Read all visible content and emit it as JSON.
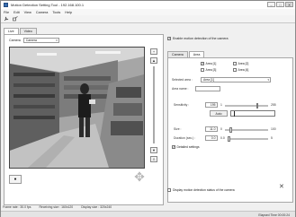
{
  "window": {
    "title": "Motion Detection Setting Tool - 192.168.100.1",
    "controls": [
      "–",
      "□",
      "✕"
    ]
  },
  "menu": [
    "File",
    "Edit",
    "View",
    "Camera",
    "Tools",
    "Help"
  ],
  "left": {
    "tabs": [
      "Live",
      "Video"
    ],
    "camera_label": "Camera",
    "camera_value": "Camera"
  },
  "right": {
    "enable_label": "Enable motion detection of the camera",
    "enable_checked": true,
    "tabs": [
      "Camera",
      "Area"
    ],
    "areas": [
      {
        "label": "Area [1]",
        "checked": true
      },
      {
        "label": "Area [2]",
        "checked": false
      },
      {
        "label": "Area [3]",
        "checked": false
      },
      {
        "label": "Area [4]",
        "checked": false
      }
    ],
    "selected_area_label": "Selected area :",
    "selected_area_value": "Area [1]",
    "area_name_label": "Area name :",
    "sensitivity_label": "Sensitivity :",
    "sensitivity_value": "195",
    "sensitivity_min": "1",
    "sensitivity_max": "255",
    "sensitivity_level": 0.76,
    "auto_label": "Auto",
    "size_label": "Size :",
    "size_value": "11.0",
    "size_min": "0",
    "size_max": "100",
    "size_level": 0.11,
    "duration_label": "Duration (sec.) :",
    "duration_value": "0.0",
    "duration_min": "0.0",
    "duration_max": "5",
    "duration_level": 0.0,
    "detailed_label": "Detailed settings",
    "detailed_checked": true,
    "display_status_label": "Display motion detection status of the camera",
    "display_status_checked": false
  },
  "status": {
    "frame_rate": "Frame rate : 30.0 fps",
    "receiving_size": "Receiving size : 160x120",
    "display_size": "Display size : 320x240",
    "elapsed": "Elapsed Time 00:00:24"
  },
  "colors": {
    "title_icon": "#3a6fb0",
    "panel_bg": "#f0f0f0",
    "frame_border": "#444444"
  }
}
